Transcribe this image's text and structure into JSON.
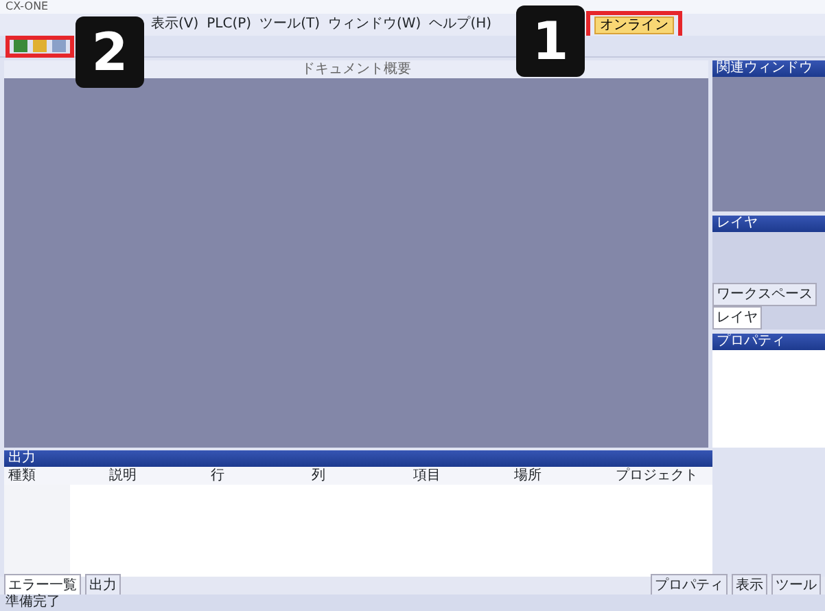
{
  "window": {
    "title": "CX-ONE"
  },
  "menu": [
    "表示(V)",
    "PLC(P)",
    "ツール(T)",
    "ウィンドウ(W)",
    "ヘルプ(H)"
  ],
  "toolbar": {
    "highlighted_button": {
      "label": "オンライン"
    }
  },
  "document": {
    "title": "ドキュメント概要"
  },
  "side_panels": [
    {
      "title": "関連ウィンドウ",
      "kind": "preview"
    },
    {
      "title": "レイヤ",
      "kind": "list",
      "tabs": [
        {
          "label": "ワークスペース",
          "selected": false
        },
        {
          "label": "レイヤ",
          "selected": true
        }
      ]
    },
    {
      "title": "プロパティ",
      "kind": "blank"
    }
  ],
  "output_panel": {
    "title": "出力",
    "columns": [
      "種類",
      "説明",
      "行",
      "列",
      "項目",
      "場所",
      "プロジェクト"
    ],
    "tabs": [
      {
        "label": "エラー一覧",
        "selected": true
      },
      {
        "label": "出力",
        "selected": false
      }
    ]
  },
  "right_tabs": [
    "プロパティ",
    "表示",
    "ツール"
  ],
  "status_bar": "準備完了",
  "callouts": [
    "2",
    "1"
  ]
}
